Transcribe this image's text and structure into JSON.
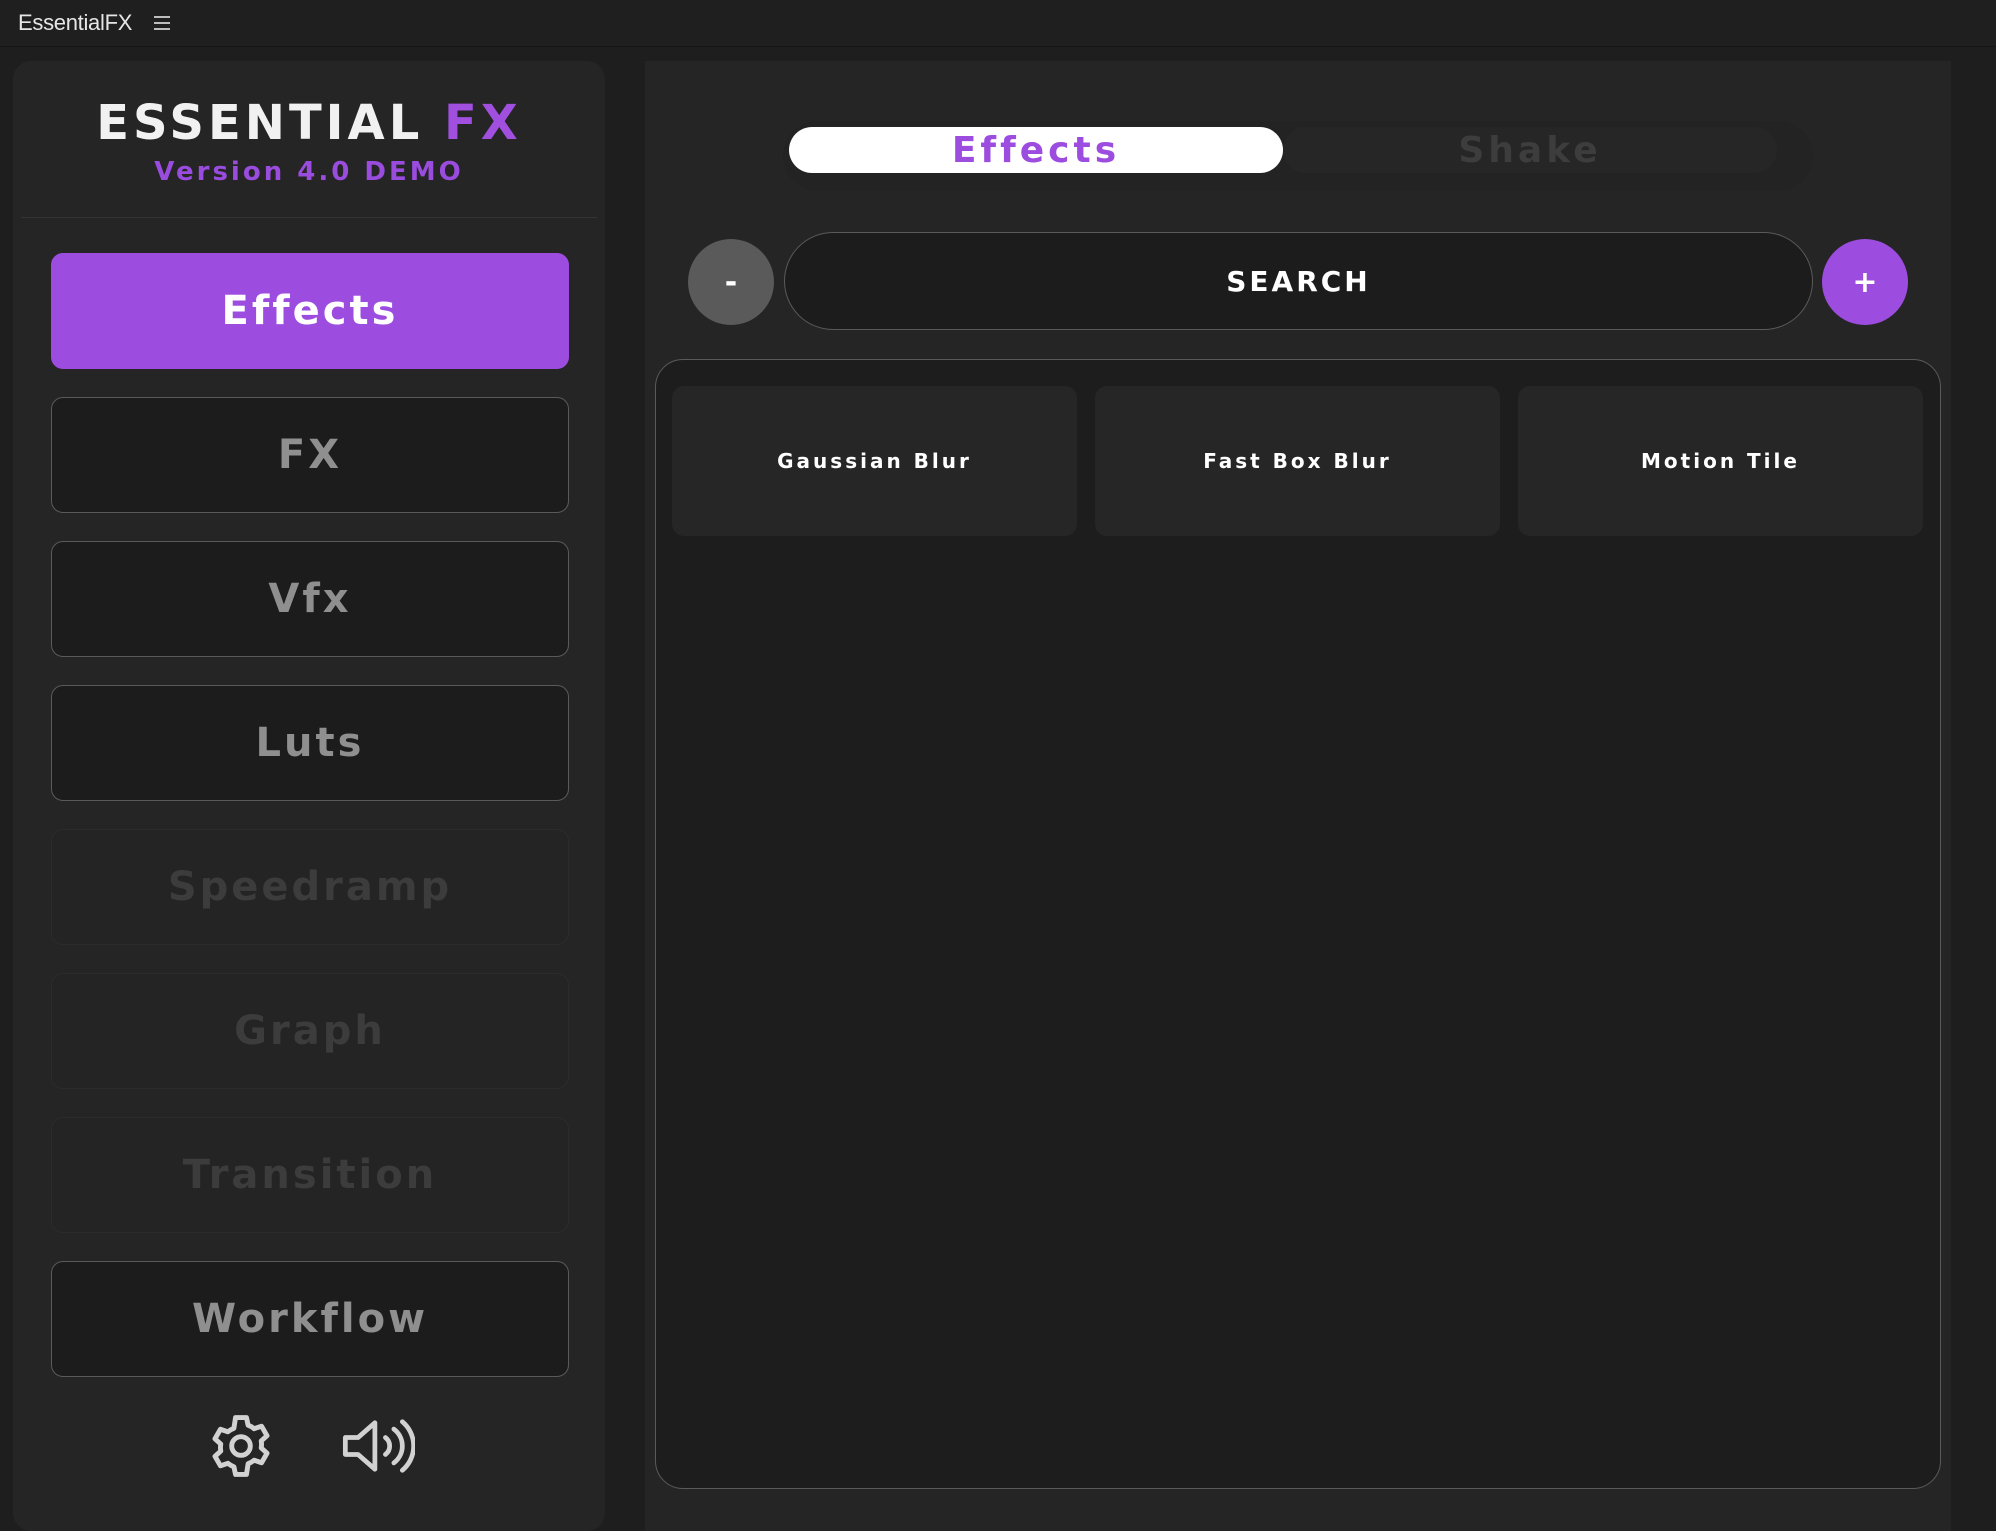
{
  "window": {
    "title": "EssentialFX"
  },
  "brand": {
    "title_main": "ESSENTIAL",
    "title_accent": "FX",
    "version": "Version 4.0 DEMO"
  },
  "nav": {
    "effects": "Effects",
    "fx": "FX",
    "vfx": "Vfx",
    "luts": "Luts",
    "speedramp": "Speedramp",
    "graph": "Graph",
    "transition": "Transition",
    "workflow": "Workflow"
  },
  "tabs": {
    "effects": "Effects",
    "shake": "Shake"
  },
  "toolbar": {
    "minus": "-",
    "search": "SEARCH",
    "plus": "+"
  },
  "cards": [
    "Gaussian Blur",
    "Fast Box Blur",
    "Motion Tile"
  ],
  "icons": {
    "settings": "gear-icon",
    "sound": "speaker-icon",
    "menu": "hamburger-icon"
  },
  "colors": {
    "accent": "#9c4ddf",
    "background": "#1e1e1e",
    "panel": "#252525"
  }
}
